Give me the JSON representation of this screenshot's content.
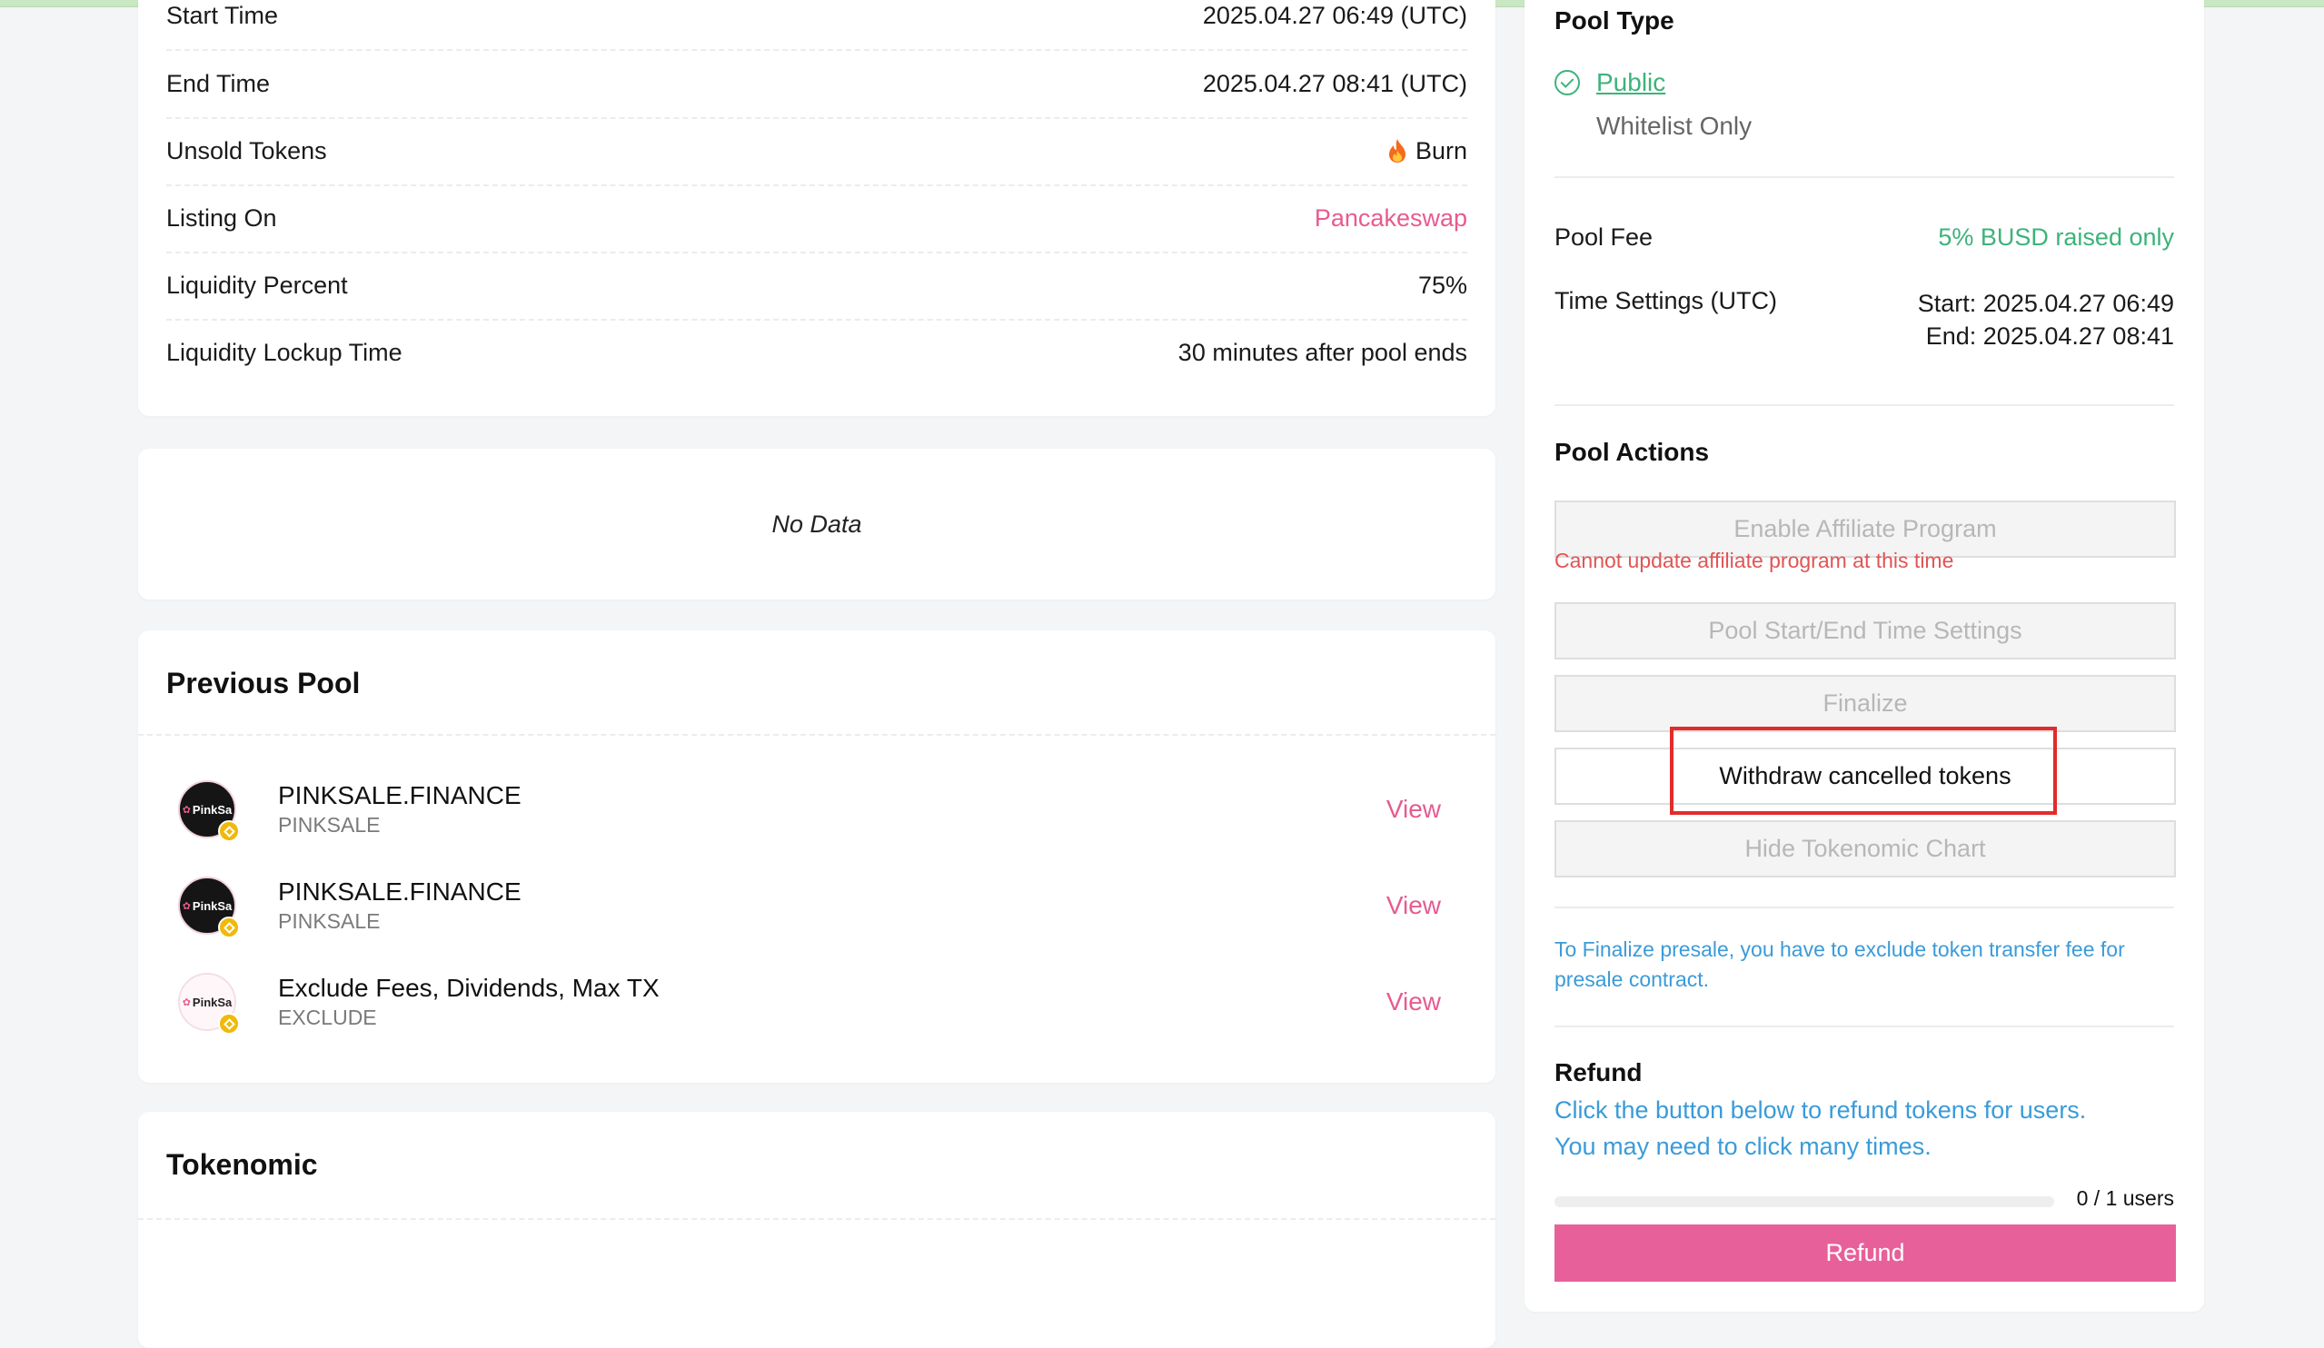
{
  "info": {
    "rows": [
      {
        "label": "Start Time",
        "value": "2025.04.27 06:49 (UTC)"
      },
      {
        "label": "End Time",
        "value": "2025.04.27 08:41 (UTC)"
      },
      {
        "label": "Unsold Tokens",
        "value": "Burn",
        "icon": "fire-icon"
      },
      {
        "label": "Listing On",
        "value": "Pancakeswap"
      },
      {
        "label": "Liquidity Percent",
        "value": "75%"
      },
      {
        "label": "Liquidity Lockup Time",
        "value": "30 minutes after pool ends"
      }
    ]
  },
  "no_data": "No Data",
  "previous_pool": {
    "title": "Previous Pool",
    "items": [
      {
        "avatar_text": "PinkSa",
        "name": "PINKSALE.FINANCE",
        "symbol": "PINKSALE",
        "action": "View"
      },
      {
        "avatar_text": "PinkSa",
        "name": "PINKSALE.FINANCE",
        "symbol": "PINKSALE",
        "action": "View"
      },
      {
        "avatar_text": "PinkSa",
        "name": "Exclude Fees, Dividends, Max TX",
        "symbol": "EXCLUDE",
        "action": "View"
      }
    ]
  },
  "tokenomic": {
    "title": "Tokenomic"
  },
  "right": {
    "pool_type": {
      "title": "Pool Type",
      "selected": "Public",
      "other": "Whitelist Only"
    },
    "pool_fee": {
      "label": "Pool Fee",
      "value": "5% BUSD raised only"
    },
    "time_settings": {
      "label": "Time Settings (UTC)",
      "start": "Start: 2025.04.27 06:49",
      "end": "End: 2025.04.27 08:41"
    },
    "actions": {
      "title": "Pool Actions",
      "affiliate": "Enable Affiliate Program",
      "affiliate_error": "Cannot update affiliate program at this time",
      "time_settings": "Pool Start/End Time Settings",
      "finalize": "Finalize",
      "withdraw": "Withdraw cancelled tokens",
      "hide_chart": "Hide Tokenomic Chart"
    },
    "finalize_note": "To Finalize presale, you have to exclude token transfer fee for presale contract.",
    "refund": {
      "title": "Refund",
      "description_line1": "Click the button below to refund tokens for users.",
      "description_line2": "You may need to click many times.",
      "progress_label": "0 / 1 users",
      "progress_fraction": 0,
      "button": "Refund"
    }
  },
  "colors": {
    "accent_pink": "#e85a8f",
    "green": "#3db37a",
    "link_blue": "#3a9bd9",
    "error_red": "#e15454",
    "highlight_red": "#e22b2b"
  }
}
